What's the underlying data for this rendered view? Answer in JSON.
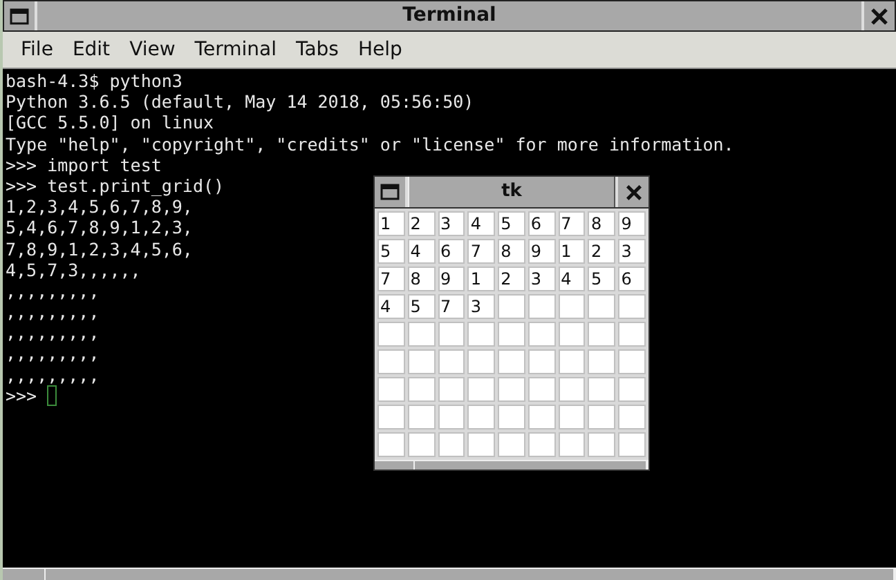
{
  "window": {
    "title": "Terminal"
  },
  "menu": [
    "File",
    "Edit",
    "View",
    "Terminal",
    "Tabs",
    "Help"
  ],
  "terminal": {
    "lines": [
      "bash-4.3$ python3",
      "Python 3.6.5 (default, May 14 2018, 05:56:50)",
      "[GCC 5.5.0] on linux",
      "Type \"help\", \"copyright\", \"credits\" or \"license\" for more information.",
      ">>> import test",
      ">>> test.print_grid()",
      "1,2,3,4,5,6,7,8,9,",
      "5,4,6,7,8,9,1,2,3,",
      "7,8,9,1,2,3,4,5,6,",
      "4,5,7,3,,,,,,",
      ",,,,,,,,,",
      ",,,,,,,,,",
      ",,,,,,,,,",
      ",,,,,,,,,",
      ",,,,,,,,,"
    ],
    "prompt": ">>> "
  },
  "tk_window": {
    "title": "tk",
    "rows": [
      [
        {
          "kind": "value",
          "value": "1"
        },
        {
          "kind": "value",
          "value": "2"
        },
        {
          "kind": "value",
          "value": "3"
        },
        {
          "kind": "value",
          "value": "4"
        },
        {
          "kind": "value",
          "value": "5"
        },
        {
          "kind": "value",
          "value": "6"
        },
        {
          "kind": "value",
          "value": "7"
        },
        {
          "kind": "value",
          "value": "8"
        },
        {
          "kind": "value",
          "value": "9"
        }
      ],
      [
        {
          "kind": "value",
          "value": "5"
        },
        {
          "kind": "value",
          "value": "4"
        },
        {
          "kind": "value",
          "value": "6"
        },
        {
          "kind": "value",
          "value": "7"
        },
        {
          "kind": "value",
          "value": "8"
        },
        {
          "kind": "value",
          "value": "9"
        },
        {
          "kind": "value",
          "value": "1"
        },
        {
          "kind": "value",
          "value": "2"
        },
        {
          "kind": "value",
          "value": "3"
        }
      ],
      [
        {
          "kind": "value",
          "value": "7"
        },
        {
          "kind": "value",
          "value": "8"
        },
        {
          "kind": "value",
          "value": "9"
        },
        {
          "kind": "value",
          "value": "1"
        },
        {
          "kind": "value",
          "value": "2"
        },
        {
          "kind": "value",
          "value": "3"
        },
        {
          "kind": "value",
          "value": "4"
        },
        {
          "kind": "value",
          "value": "5"
        },
        {
          "kind": "value",
          "value": "6"
        }
      ],
      [
        {
          "kind": "value",
          "value": "4"
        },
        {
          "kind": "value",
          "value": "5"
        },
        {
          "kind": "value",
          "value": "7"
        },
        {
          "kind": "value",
          "value": "3"
        },
        {
          "kind": "empty"
        },
        {
          "kind": "empty"
        },
        {
          "kind": "empty"
        },
        {
          "kind": "empty"
        },
        {
          "kind": "empty"
        }
      ],
      [
        {
          "kind": "empty"
        },
        {
          "kind": "empty"
        },
        {
          "kind": "empty"
        },
        {
          "kind": "empty"
        },
        {
          "kind": "empty"
        },
        {
          "kind": "empty"
        },
        {
          "kind": "empty"
        },
        {
          "kind": "empty"
        },
        {
          "kind": "empty"
        }
      ],
      [
        {
          "kind": "empty"
        },
        {
          "kind": "empty"
        },
        {
          "kind": "empty"
        },
        {
          "kind": "empty"
        },
        {
          "kind": "empty"
        },
        {
          "kind": "empty"
        },
        {
          "kind": "empty"
        },
        {
          "kind": "empty"
        },
        {
          "kind": "empty"
        }
      ],
      [
        {
          "kind": "empty"
        },
        {
          "kind": "empty"
        },
        {
          "kind": "empty"
        },
        {
          "kind": "empty"
        },
        {
          "kind": "empty"
        },
        {
          "kind": "empty"
        },
        {
          "kind": "empty"
        },
        {
          "kind": "empty"
        },
        {
          "kind": "empty"
        }
      ],
      [
        {
          "kind": "empty"
        },
        {
          "kind": "empty"
        },
        {
          "kind": "empty"
        },
        {
          "kind": "empty"
        },
        {
          "kind": "empty"
        },
        {
          "kind": "empty"
        },
        {
          "kind": "empty"
        },
        {
          "kind": "empty"
        },
        {
          "kind": "empty"
        }
      ],
      [
        {
          "kind": "empty"
        },
        {
          "kind": "empty"
        },
        {
          "kind": "empty"
        },
        {
          "kind": "empty"
        },
        {
          "kind": "empty"
        },
        {
          "kind": "empty"
        },
        {
          "kind": "empty"
        },
        {
          "kind": "empty"
        },
        {
          "kind": "empty"
        }
      ]
    ]
  }
}
